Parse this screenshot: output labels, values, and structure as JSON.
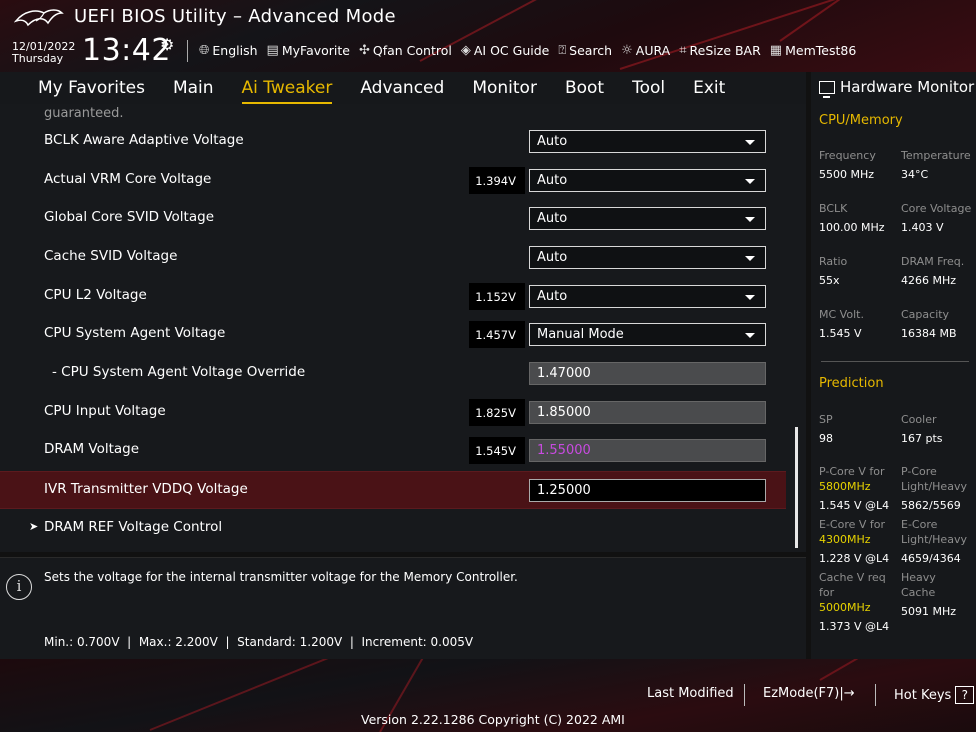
{
  "header": {
    "title": "UEFI BIOS Utility – Advanced Mode",
    "date": "12/01/2022",
    "day": "Thursday",
    "time": "13:42",
    "tools": [
      {
        "icon": "globe-icon",
        "label": "English"
      },
      {
        "icon": "favorite-icon",
        "label": "MyFavorite"
      },
      {
        "icon": "fan-icon",
        "label": "Qfan Control"
      },
      {
        "icon": "ai-oc-icon",
        "label": "AI OC Guide"
      },
      {
        "icon": "search-icon",
        "label": "Search"
      },
      {
        "icon": "aura-icon",
        "label": "AURA"
      },
      {
        "icon": "resize-bar-icon",
        "label": "ReSize BAR"
      },
      {
        "icon": "memtest-icon",
        "label": "MemTest86"
      }
    ]
  },
  "nav": {
    "tabs": [
      "My Favorites",
      "Main",
      "Ai Tweaker",
      "Advanced",
      "Monitor",
      "Boot",
      "Tool",
      "Exit"
    ],
    "active": "Ai Tweaker"
  },
  "main": {
    "partial_text": "guaranteed.",
    "rows": [
      {
        "label": "BCLK Aware Adaptive Voltage",
        "badge": "",
        "value": "Auto",
        "type": "select"
      },
      {
        "label": "Actual VRM Core Voltage",
        "badge": "1.394V",
        "value": "Auto",
        "type": "select"
      },
      {
        "label": "Global Core SVID Voltage",
        "badge": "",
        "value": "Auto",
        "type": "select"
      },
      {
        "label": "Cache SVID Voltage",
        "badge": "",
        "value": "Auto",
        "type": "select"
      },
      {
        "label": "CPU L2 Voltage",
        "badge": "1.152V",
        "value": "Auto",
        "type": "select"
      },
      {
        "label": "CPU System Agent Voltage",
        "badge": "1.457V",
        "value": "Manual Mode",
        "type": "select"
      },
      {
        "label": "- CPU System Agent Voltage Override",
        "badge": "",
        "value": "1.47000",
        "type": "input"
      },
      {
        "label": "CPU Input Voltage",
        "badge": "1.825V",
        "value": "1.85000",
        "type": "input"
      },
      {
        "label": "DRAM Voltage",
        "badge": "1.545V",
        "value": "1.55000",
        "type": "input-magenta"
      },
      {
        "label": "IVR Transmitter VDDQ Voltage",
        "badge": "",
        "value": "1.25000",
        "type": "input-selected"
      },
      {
        "label": "DRAM REF Voltage Control",
        "badge": "",
        "value": "",
        "type": "submenu"
      }
    ]
  },
  "help": {
    "description": "Sets the voltage for the internal transmitter voltage for the Memory Controller.",
    "limits": "Min.: 0.700V  |  Max.: 2.200V  |  Standard: 1.200V  |  Increment: 0.005V"
  },
  "hw_monitor": {
    "title": "Hardware Monitor",
    "cpu_memory": {
      "section": "CPU/Memory",
      "frequency_label": "Frequency",
      "frequency": "5500 MHz",
      "temperature_label": "Temperature",
      "temperature": "34°C",
      "bclk_label": "BCLK",
      "bclk": "100.00 MHz",
      "core_voltage_label": "Core Voltage",
      "core_voltage": "1.403 V",
      "ratio_label": "Ratio",
      "ratio": "55x",
      "dram_freq_label": "DRAM Freq.",
      "dram_freq": "4266 MHz",
      "mc_volt_label": "MC Volt.",
      "mc_volt": "1.545 V",
      "capacity_label": "Capacity",
      "capacity": "16384 MB"
    },
    "prediction": {
      "section": "Prediction",
      "sp_label": "SP",
      "sp": "98",
      "cooler_label": "Cooler",
      "cooler": "167 pts",
      "pcore_v_label": "P-Core V for",
      "pcore_v_freq": "5800MHz",
      "pcore_v": "1.545 V @L4",
      "pcore_lh_label": "P-Core Light/Heavy",
      "pcore_lh": "5862/5569",
      "ecore_v_label": "E-Core V for",
      "ecore_v_freq": "4300MHz",
      "ecore_v": "1.228 V @L4",
      "ecore_lh_label": "E-Core Light/Heavy",
      "ecore_lh": "4659/4364",
      "cache_v_label": "Cache V req for",
      "cache_v_freq": "5000MHz",
      "cache_v": "1.373 V @L4",
      "heavy_cache_label": "Heavy Cache",
      "heavy_cache": "5091 MHz"
    }
  },
  "footer": {
    "last_modified": "Last Modified",
    "ezmode": "EzMode(F7)|→",
    "hotkeys": "Hot Keys",
    "hotkeys_key": "?",
    "version": "Version 2.22.1286 Copyright (C) 2022 AMI"
  },
  "colors": {
    "accent": "#e6b800",
    "selected_row": "#4a1216",
    "dram_value": "#c84be0"
  }
}
